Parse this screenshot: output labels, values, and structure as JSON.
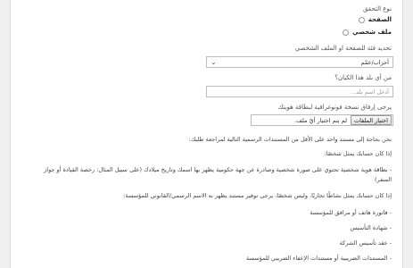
{
  "form": {
    "verification_type_label": "نوع التحقق",
    "radio_options": [
      "الصفحة",
      "ملف شخصي"
    ],
    "category_label": "تحديد فئة للصفحة او الملف الشخصي",
    "category_value": "أحزاب/عمّم",
    "country_label": "من أي بلد هذا الكيان؟",
    "country_placeholder": "أدخل اسم بلد...",
    "attach_label": "يرجى إرفاق نسخة فوتوغرافية لبطاقة هويتك",
    "file_button": "اختيار الملفات",
    "file_status": "لم يتم اختيار أيّ ملف."
  },
  "instructions": {
    "intro": "نحن بحاجة إلى مستند واحد على الأقل من المستندات الرسمية التالية لمراجعة طلبك:",
    "if_person": "إذا كان حسابك يمثل شخصًا:",
    "id_doc_line1": "- بطاقة هوية شخصية تحتوي على صورة شخصية وصادرة عن جهة حكومية يظهر بها اسمك وتاريخ ميلادك (على سبيل المثال: رخصة القيادة أو جواز",
    "id_doc_line2": "السفر)",
    "if_business": "إذا كان حسابك يمثل نشاطًا تجاريًا، وليس شخصًا، يرجى توفير مستند يظهر به الاسم الرسمي/القانوني للمؤسسة:",
    "business_docs": [
      "- فاتورة هاتف أو مرافق للمؤسسة",
      "- شهادة التأسيس",
      "- عقد تأسيس الشركة",
      "- المستندات الضريبية أو مستندات الإعفاء الضريبي للمؤسسة"
    ]
  }
}
